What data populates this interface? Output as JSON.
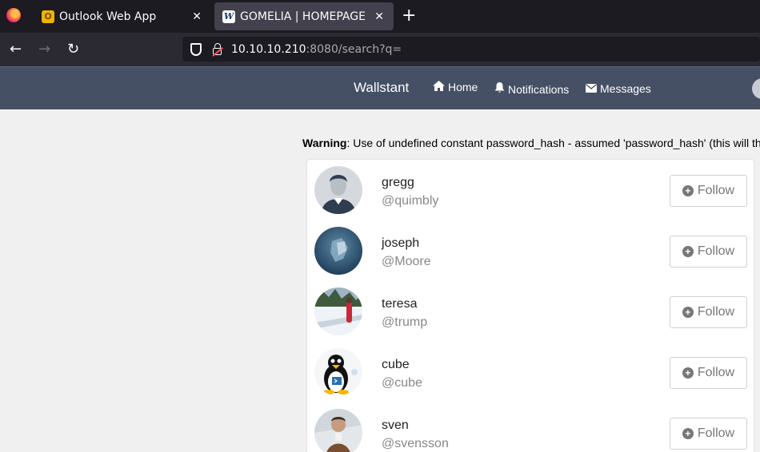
{
  "browser": {
    "tabs": [
      {
        "title": "Outlook Web App",
        "favicon": "outlook-icon"
      },
      {
        "title": "GOMELIA | HOMEPAGE",
        "favicon": "w-icon",
        "active": true
      }
    ],
    "url_host": "10.10.10.210",
    "url_rest": ":8080/search?q="
  },
  "site": {
    "brand": "Wallstant",
    "nav": {
      "home": "Home",
      "notifications": "Notifications",
      "messages": "Messages"
    }
  },
  "warning": {
    "label": "Warning",
    "text": ": Use of undefined constant password_hash - assumed 'password_hash' (this will th"
  },
  "users": [
    {
      "name": "gregg",
      "handle": "@quimbly",
      "follow": "Follow"
    },
    {
      "name": "joseph",
      "handle": "@Moore",
      "follow": "Follow"
    },
    {
      "name": "teresa",
      "handle": "@trump",
      "follow": "Follow"
    },
    {
      "name": "cube",
      "handle": "@cube",
      "follow": "Follow"
    },
    {
      "name": "sven",
      "handle": "@svensson",
      "follow": "Follow"
    }
  ],
  "colors": {
    "header": "#465064",
    "browser_dark": "#1c1b22"
  }
}
